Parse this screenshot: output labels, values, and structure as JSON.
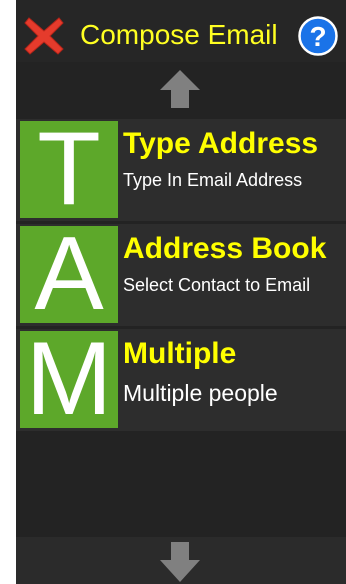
{
  "header": {
    "title": "Compose Email",
    "close_icon": "red-x-close-icon",
    "help_icon": "blue-question-help-icon"
  },
  "nav": {
    "up_icon": "up-arrow-icon",
    "down_icon": "down-arrow-icon"
  },
  "options": [
    {
      "letter": "T",
      "title": "Type Address",
      "subtitle": "Type In Email Address"
    },
    {
      "letter": "A",
      "title": "Address Book",
      "subtitle": "Select Contact to Email"
    },
    {
      "letter": "M",
      "title": "Multiple",
      "subtitle": "Multiple people"
    }
  ],
  "colors": {
    "title_yellow": "#ffff00",
    "tile_green": "#5da82a",
    "background": "#232323"
  }
}
